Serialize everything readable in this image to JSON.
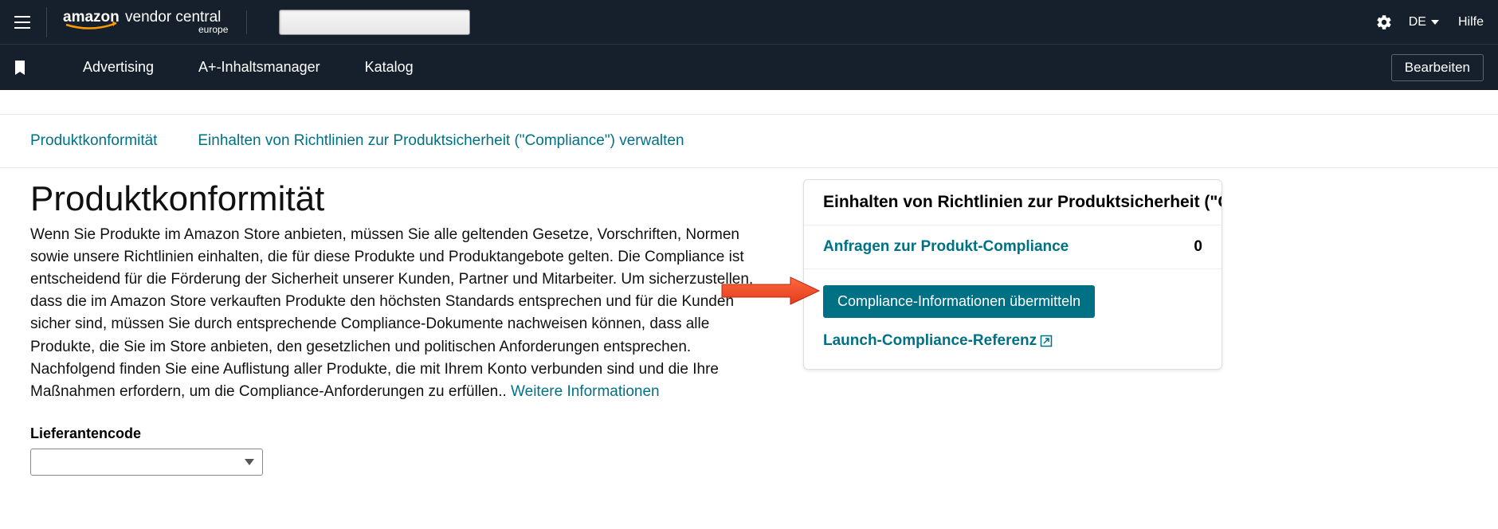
{
  "header": {
    "logo_main": "amazon",
    "logo_sub1": "vendor central",
    "logo_sub2": "europe",
    "language": "DE",
    "help": "Hilfe"
  },
  "nav": {
    "items": [
      "Advertising",
      "A+-Inhaltsmanager",
      "Katalog"
    ],
    "edit": "Bearbeiten"
  },
  "breadcrumb": {
    "a": "Produktkonformität",
    "b": "Einhalten von Richtlinien zur Produktsicherheit (\"Compliance\") verwalten"
  },
  "main": {
    "title": "Produktkonformität",
    "intro": "Wenn Sie Produkte im Amazon Store anbieten, müssen Sie alle geltenden Gesetze, Vorschriften, Normen sowie unsere Richtlinien einhalten, die für diese Produkte und Produktangebote gelten. Die Compliance ist entscheidend für die Förderung der Sicherheit unserer Kunden, Partner und Mitarbeiter. Um sicherzustellen, dass die im Amazon Store verkauften Produkte den höchsten Standards entsprechen und für die Kunden sicher sind, müssen Sie durch entsprechende Compliance-Dokumente nachweisen können, dass alle Produkte, die Sie im Store anbieten, den gesetzlichen und politischen Anforderungen entsprechen. Nachfolgend finden Sie eine Auflistung aller Produkte, die mit Ihrem Konto verbunden sind und die Ihre Maßnahmen erfordern, um die Compliance-Anforderungen zu erfüllen.. ",
    "more_link": "Weitere Informationen",
    "supplier_label": "Lieferantencode",
    "supplier_value": ""
  },
  "panel": {
    "title": "Einhalten von Richtlinien zur Produktsicherheit (\"Comp",
    "row_label": "Anfragen zur Produkt-Compliance",
    "row_count": "0",
    "submit_btn": "Compliance-Informationen übermitteln",
    "ref_link": "Launch-Compliance-Referenz"
  }
}
